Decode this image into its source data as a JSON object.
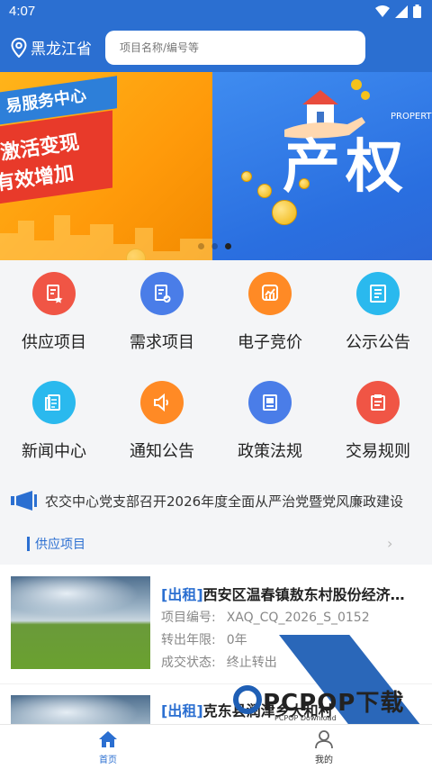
{
  "status": {
    "time": "4:07"
  },
  "header": {
    "location": "黑龙江省",
    "search_placeholder": "项目名称/编号等"
  },
  "banner": {
    "left": {
      "ribbon_top": "易服务中心",
      "line1": "激活变现",
      "line2": "有效增加"
    },
    "right": {
      "headline": "产权",
      "sub": "PROPERT"
    },
    "dots": 3,
    "active_dot": 3
  },
  "grid": [
    {
      "label": "供应项目",
      "color": "#f05545",
      "icon": "supply-icon"
    },
    {
      "label": "需求项目",
      "color": "#4a7de8",
      "icon": "demand-icon"
    },
    {
      "label": "电子竞价",
      "color": "#ff8a25",
      "icon": "bidding-icon"
    },
    {
      "label": "公示公告",
      "color": "#2ab9ee",
      "icon": "bulletin-icon"
    },
    {
      "label": "新闻中心",
      "color": "#2ab9ee",
      "icon": "news-icon"
    },
    {
      "label": "通知公告",
      "color": "#ff8a25",
      "icon": "speaker-icon"
    },
    {
      "label": "政策法规",
      "color": "#4a7de8",
      "icon": "policy-icon"
    },
    {
      "label": "交易规则",
      "color": "#f05545",
      "icon": "rules-icon"
    }
  ],
  "notice": {
    "text": "农交中心党支部召开2026年度全面从严治党暨党风廉政建设"
  },
  "section": {
    "title": "供应项目"
  },
  "list": [
    {
      "tag": "[出租]",
      "title": "西安区温春镇敖东村股份经济…",
      "meta": [
        {
          "label": "项目编号:",
          "value": "XAQ_CQ_2026_S_0152"
        },
        {
          "label": "转出年限:",
          "value": "0年"
        },
        {
          "label": "成交状态:",
          "value": "终止转出"
        }
      ]
    },
    {
      "tag": "[出租]",
      "title": "克东县润津乡大和村"
    }
  ],
  "watermark": {
    "logo": "PCPOP下载",
    "sub": "PCPOP Download"
  },
  "tabbar": {
    "home": "首页",
    "mine": "我的"
  }
}
